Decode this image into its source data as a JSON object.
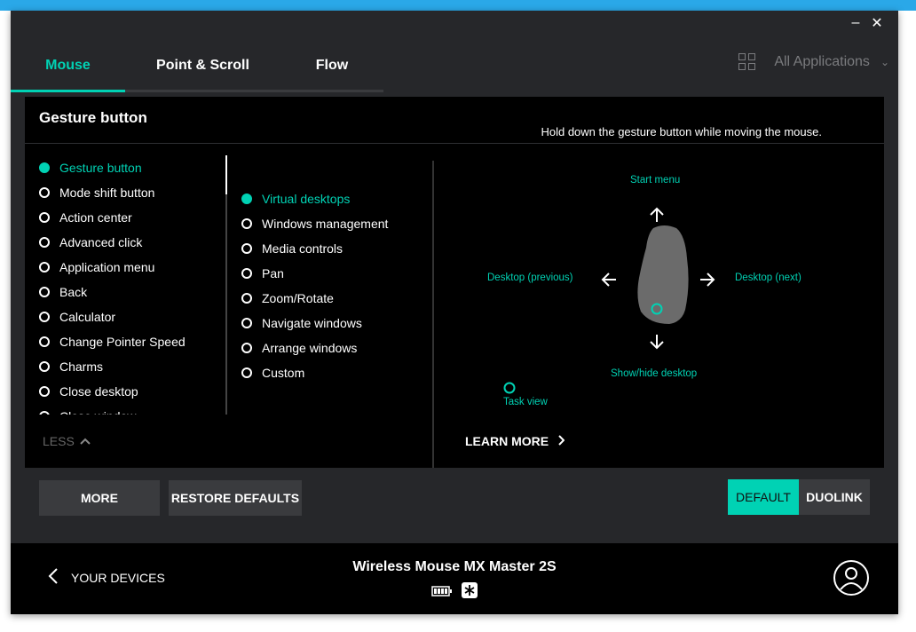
{
  "window": {
    "minimize": "–",
    "close": "✕"
  },
  "tabs": [
    {
      "label": "Mouse",
      "active": true
    },
    {
      "label": "Point & Scroll",
      "active": false
    },
    {
      "label": "Flow",
      "active": false
    }
  ],
  "apps": {
    "label": "All Applications",
    "icon": "grid-icon"
  },
  "panel": {
    "title": "Gesture button",
    "hint": "Hold down the gesture button while moving the mouse."
  },
  "buttons_list": [
    "Gesture button",
    "Mode shift button",
    "Action center",
    "Advanced click",
    "Application menu",
    "Back",
    "Calculator",
    "Change Pointer Speed",
    "Charms",
    "Close desktop",
    "Close window"
  ],
  "gesture_modes": [
    "Virtual desktops",
    "Windows management",
    "Media controls",
    "Pan",
    "Zoom/Rotate",
    "Navigate windows",
    "Arrange windows",
    "Custom"
  ],
  "less_label": "LESS",
  "diagram": {
    "up": "Start menu",
    "left": "Desktop (previous)",
    "right": "Desktop (next)",
    "down": "Show/hide desktop",
    "tap": "Task view"
  },
  "learn_more": "LEARN MORE",
  "actions": {
    "more": "MORE",
    "restore": "RESTORE DEFAULTS",
    "default": "DEFAULT",
    "duolink": "DUOLINK"
  },
  "footer": {
    "back_label": "YOUR DEVICES",
    "device_name": "Wireless Mouse MX Master 2S"
  },
  "colors": {
    "accent": "#00d2b4",
    "panel": "#000000",
    "window": "#26272a"
  }
}
